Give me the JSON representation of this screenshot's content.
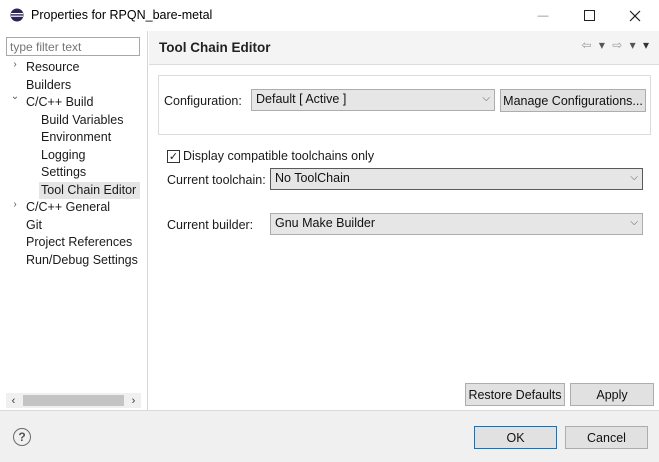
{
  "window": {
    "title": "Properties for RPQN_bare-metal",
    "minimize_glyph": "—",
    "maximize_glyph": "☐",
    "close_glyph": "✕"
  },
  "sidebar": {
    "filter_placeholder": "type filter text",
    "items": [
      {
        "label": "Resource",
        "arrow": "›"
      },
      {
        "label": "Builders",
        "arrow": ""
      },
      {
        "label": "C/C++ Build",
        "arrow": "⌄"
      },
      {
        "label": "Build Variables",
        "arrow": ""
      },
      {
        "label": "Environment",
        "arrow": ""
      },
      {
        "label": "Logging",
        "arrow": ""
      },
      {
        "label": "Settings",
        "arrow": ""
      },
      {
        "label": "Tool Chain Editor",
        "arrow": ""
      },
      {
        "label": "C/C++ General",
        "arrow": "›"
      },
      {
        "label": "Git",
        "arrow": ""
      },
      {
        "label": "Project References",
        "arrow": ""
      },
      {
        "label": "Run/Debug Settings",
        "arrow": ""
      }
    ],
    "scroll_left": "‹",
    "scroll_right": "›"
  },
  "page": {
    "title": "Tool Chain Editor",
    "nav": {
      "back": "⇦",
      "back_menu": "▾",
      "forward": "⇨",
      "forward_menu": "▾",
      "view_menu": "▾"
    }
  },
  "configuration": {
    "label": "Configuration:",
    "value": "Default  [ Active ]",
    "manage_button": "Manage Configurations..."
  },
  "toolchain": {
    "display_compatible_label": "Display compatible toolchains only",
    "display_compatible_checked": true,
    "current_toolchain_label": "Current toolchain:",
    "current_toolchain_value": "No ToolChain",
    "current_builder_label": "Current builder:",
    "current_builder_value": "Gnu Make Builder"
  },
  "page_buttons": {
    "restore_defaults": "Restore Defaults",
    "apply": "Apply"
  },
  "dialog_buttons": {
    "ok": "OK",
    "cancel": "Cancel",
    "help_glyph": "?"
  },
  "colors": {
    "selection": "#e5e5e5",
    "default_button_border": "#0078d7",
    "button_face": "#e1e1e1"
  }
}
